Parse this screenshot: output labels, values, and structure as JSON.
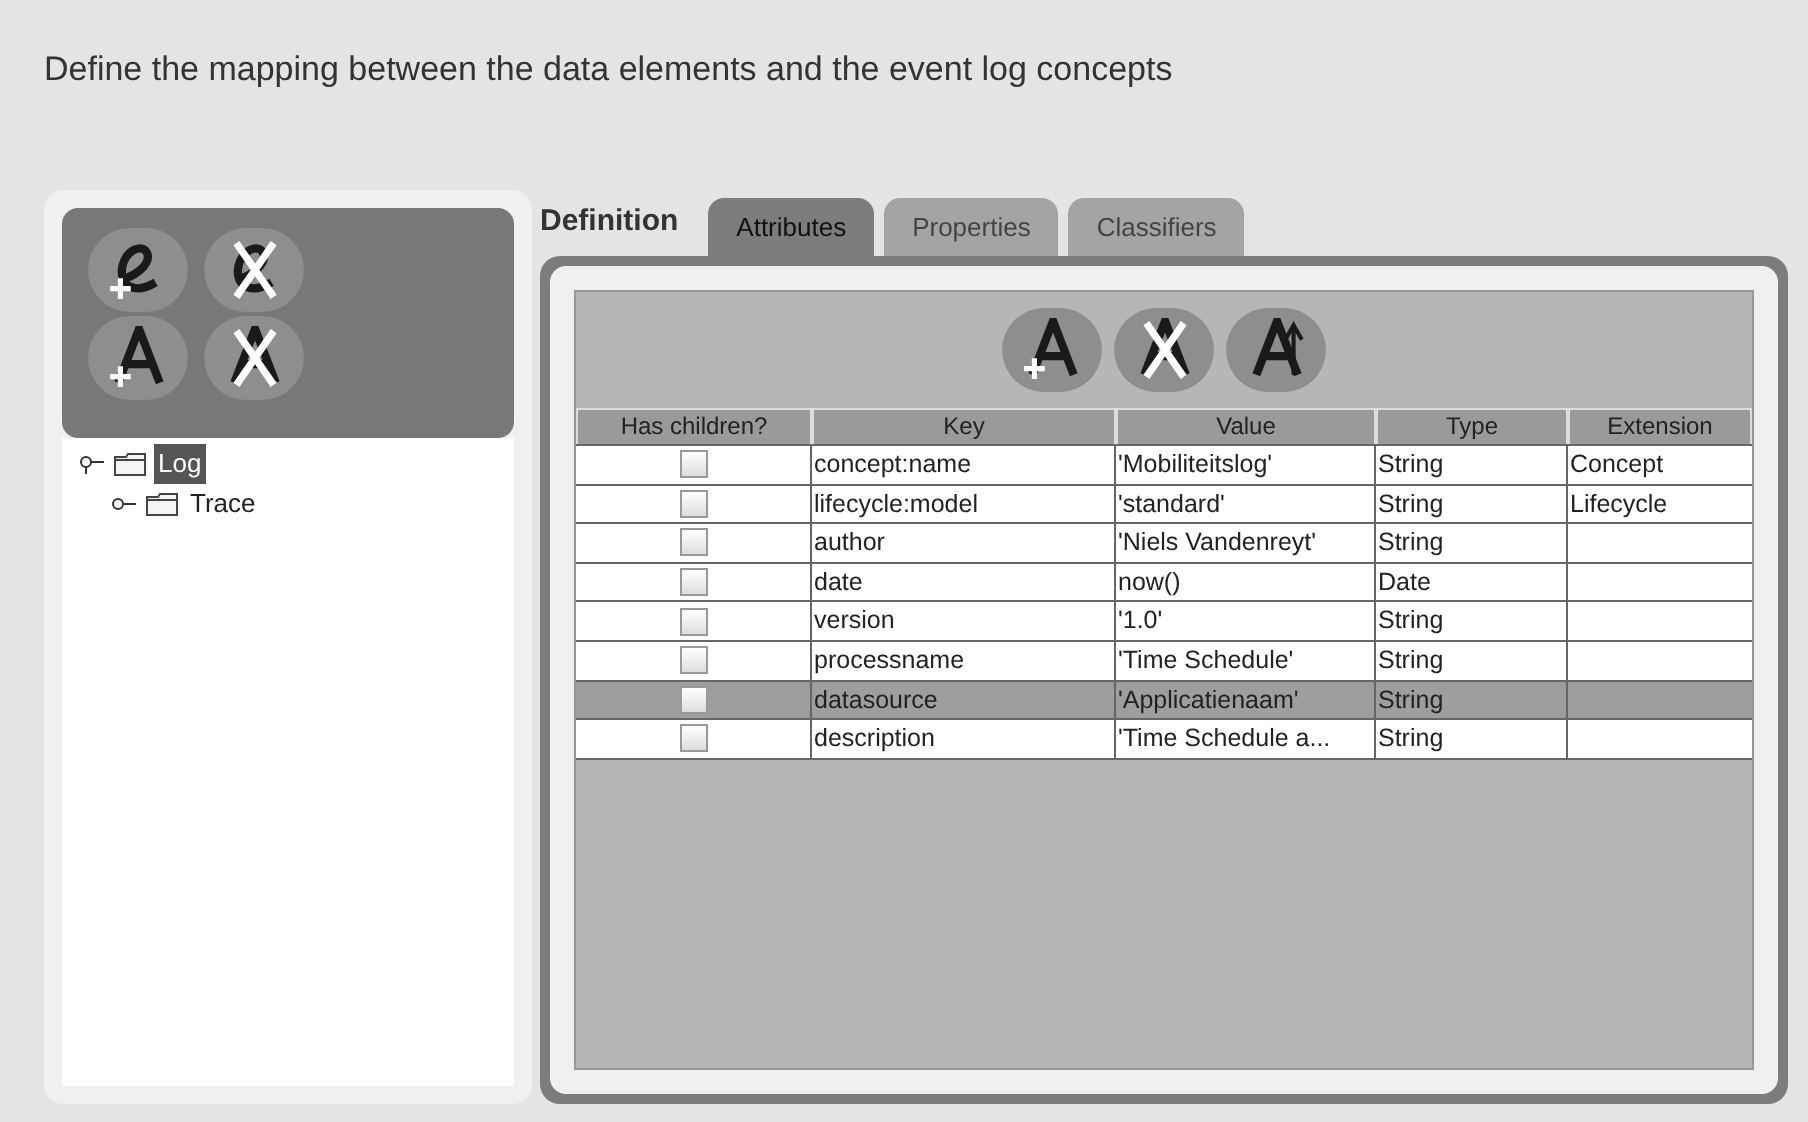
{
  "heading": "Define the mapping between the data elements and the event log concepts",
  "tool_buttons": [
    {
      "kind": "add-extension"
    },
    {
      "kind": "remove-extension"
    },
    {
      "kind": "add-attribute"
    },
    {
      "kind": "remove-attribute"
    }
  ],
  "tree": [
    {
      "label": "Log",
      "selected": true,
      "expanded": true,
      "children": [
        {
          "label": "Trace",
          "selected": false,
          "expanded": false
        }
      ]
    }
  ],
  "definition_label": "Definition",
  "tabs": [
    {
      "label": "Attributes",
      "selected": true
    },
    {
      "label": "Properties",
      "selected": false
    },
    {
      "label": "Classifiers",
      "selected": false
    }
  ],
  "attribute_buttons": [
    {
      "kind": "add-attribute"
    },
    {
      "kind": "remove-attribute"
    },
    {
      "kind": "move-attribute"
    }
  ],
  "table": {
    "columns": [
      "Has children?",
      "Key",
      "Value",
      "Type",
      "Extension"
    ],
    "rows": [
      {
        "checked": false,
        "selected": false,
        "key": "concept:name",
        "value": "'Mobiliteitslog'",
        "type": "String",
        "extension": "Concept"
      },
      {
        "checked": false,
        "selected": false,
        "key": "lifecycle:model",
        "value": "'standard'",
        "type": "String",
        "extension": "Lifecycle"
      },
      {
        "checked": false,
        "selected": false,
        "key": "author",
        "value": "'Niels Vandenreyt'",
        "type": "String"
      },
      {
        "checked": false,
        "selected": false,
        "key": "date",
        "value": "now()",
        "type": "Date"
      },
      {
        "checked": false,
        "selected": false,
        "key": "version",
        "value": "'1.0'",
        "type": "String"
      },
      {
        "checked": false,
        "selected": false,
        "key": "processname",
        "value": "'Time Schedule'",
        "type": "String"
      },
      {
        "checked": false,
        "selected": true,
        "key": "datasource",
        "value": "'Applicatienaam'",
        "type": "String"
      },
      {
        "checked": false,
        "selected": false,
        "key": "description",
        "value": "'Time Schedule a...",
        "type": "String"
      }
    ]
  }
}
